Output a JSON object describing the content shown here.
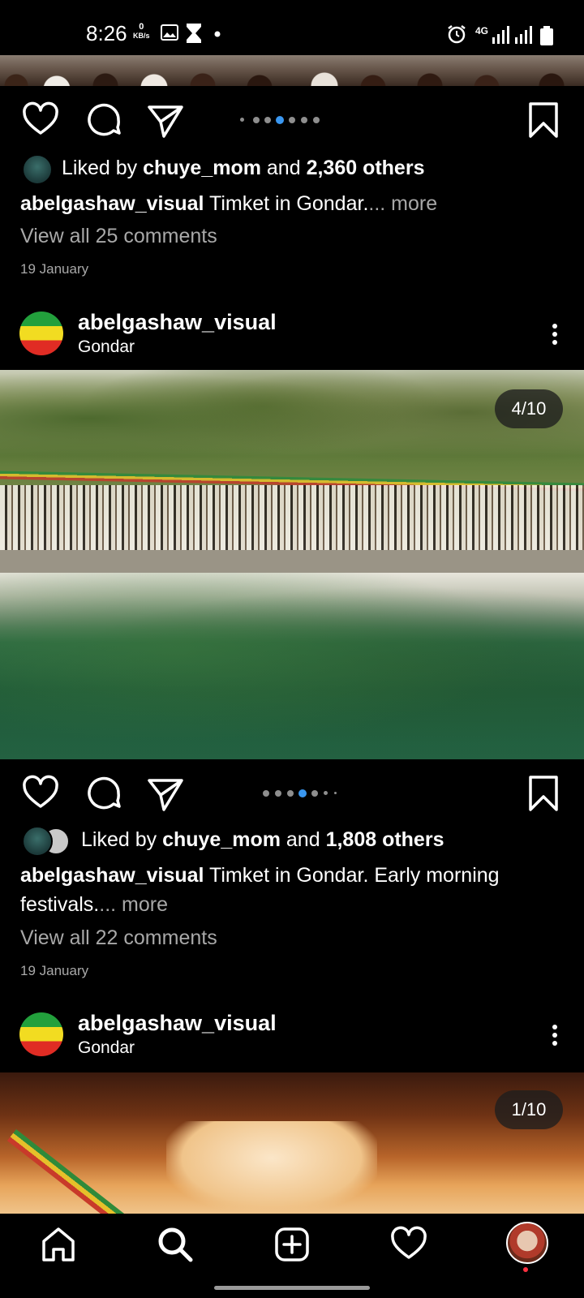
{
  "status_bar": {
    "time": "8:26",
    "net_speed_value": "0",
    "net_speed_unit": "KB/s",
    "network": "4G"
  },
  "posts": [
    {
      "id": "post_prev",
      "carousel_dots": 7,
      "carousel_active": 3,
      "likes": {
        "prefix": "Liked by ",
        "user": "chuye_mom",
        "and": " and ",
        "count": "2,360 others"
      },
      "caption": {
        "user": "abelgashaw_visual",
        "text": " Timket in Gondar.",
        "more": "... more"
      },
      "comments": "View all 25 comments",
      "date": "19 January"
    },
    {
      "id": "post_mid",
      "header": {
        "username": "abelgashaw_visual",
        "location": "Gondar"
      },
      "counter": "4/10",
      "carousel_active": 4,
      "likes": {
        "prefix": "Liked by ",
        "user": "chuye_mom",
        "and": " and ",
        "count": "1,808 others"
      },
      "caption": {
        "user": "abelgashaw_visual",
        "text": " Timket in Gondar. Early morning festivals.",
        "more": "... more"
      },
      "comments": "View all 22 comments",
      "date": "19 January"
    },
    {
      "id": "post_next",
      "header": {
        "username": "abelgashaw_visual",
        "location": "Gondar"
      },
      "counter": "1/10"
    }
  ],
  "colors": {
    "background": "#000000",
    "text": "#ffffff",
    "muted": "#a8a8a8",
    "carousel_active": "#3a97f0",
    "notification_dot": "#ff3040"
  },
  "nav": {
    "items": [
      "home-icon",
      "search-icon",
      "create-icon",
      "activity-icon",
      "profile-avatar"
    ]
  }
}
